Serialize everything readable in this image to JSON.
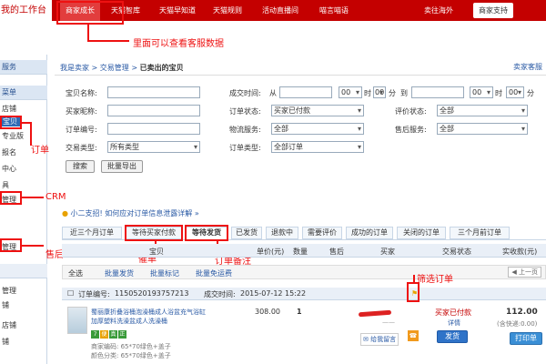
{
  "topbar": {
    "logo": "我的工作台",
    "nav": [
      "商家成长",
      "天猫智库",
      "天猫早知道",
      "天猫规则",
      "活动直播间",
      "喵言喵语"
    ],
    "right1": "卖往海外",
    "right2": "商家支持"
  },
  "annotations": {
    "service_data": "里面可以查看客服数据",
    "orders": "订单",
    "crm": "CRM",
    "after_sales": "售后",
    "urge_payment": "催单",
    "order_note": "订单备注",
    "filter_orders": "筛选订单"
  },
  "sidebar": {
    "head1": "服务",
    "head2": "菜单",
    "items": [
      "店铺",
      "宝贝",
      "专业版",
      "报名",
      "中心",
      "具",
      "管理",
      "",
      "管理"
    ],
    "lower": [
      "管理",
      "铺",
      "店铺",
      "铺"
    ]
  },
  "breadcrumb": {
    "home": "我是卖家",
    "section": "交易管理",
    "current": "已卖出的宝贝",
    "help": "卖家客服"
  },
  "filters": {
    "item_name": "宝贝名称:",
    "buyer_nick": "买家昵称:",
    "order_no": "订单编号:",
    "trade_type": "交易类型:",
    "trade_type_value": "所有类型",
    "time_label": "成交时间:",
    "from": "从",
    "to": "到",
    "hour": "00",
    "min": "00",
    "hour_unit": "时",
    "min_unit": "分",
    "status_label": "订单状态:",
    "status_value": "买家已付款",
    "logistics_label": "物流服务:",
    "logistics_value": "全部",
    "order_type_label": "订单类型:",
    "order_type_value": "全部订单",
    "rate_label": "评价状态:",
    "rate_value": "全部",
    "aftersale_label": "售后服务:",
    "aftersale_value": "全部",
    "search_btn": "搜索",
    "export_btn": "批量导出"
  },
  "tip": "小二支招! 如何应对订单信息泄露详解 »",
  "tabs": [
    "近三个月订单",
    "等待买家付款",
    "等待发货",
    "已发货",
    "退款中",
    "需要评价",
    "成功的订单",
    "关闭的订单",
    "三个月前订单"
  ],
  "table_header": {
    "item": "宝贝",
    "price": "单价(元)",
    "qty": "数量",
    "aftersale": "售后",
    "buyer": "买家",
    "status": "交易状态",
    "paid": "实收款(元)"
  },
  "bulk": {
    "select_all": "全选",
    "ship": "批量发货",
    "mark": "批量标记",
    "free_ship": "批量免运费",
    "pager": "上一页"
  },
  "order": {
    "no_label": "订单编号:",
    "no": "1150520193757213",
    "time_label": "成交时间:",
    "time": "2015-07-12 15:22",
    "title1": "蜀丽康折叠浴桶泡澡桶成人浴盆充气浴缸",
    "title2": "加厚塑料洗澡盆成人洗澡桶",
    "badges": [
      "7",
      "便",
      "真",
      "正"
    ],
    "code": "商家编码: 65*70绿色+盖子",
    "color": "颜色分类: 65*70绿色+盖子",
    "price": "308.00",
    "qty": "1",
    "status": "买家已付款",
    "detail": "详情",
    "ship_btn": "发货",
    "paid": "112.00",
    "shipping": "(含快递:0.00)",
    "leave_msg": "给我留言",
    "print": "打印单"
  }
}
